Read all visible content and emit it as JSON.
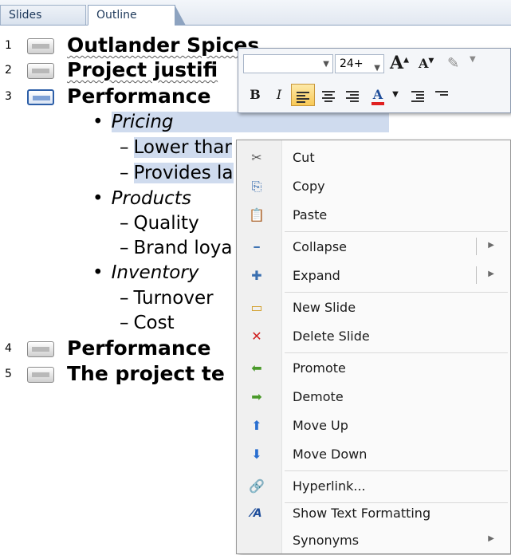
{
  "tabs": {
    "slides": "Slides",
    "outline": "Outline"
  },
  "outline": {
    "slides": [
      {
        "num": "1",
        "title": "Outlander Spices"
      },
      {
        "num": "2",
        "title": "Project justifi"
      },
      {
        "num": "3",
        "title": "Performance"
      },
      {
        "num": "4",
        "title": "Performance"
      },
      {
        "num": "5",
        "title": "The project te"
      }
    ],
    "bullets": [
      {
        "text": "Pricing",
        "subs": [
          "Lower thar",
          "Provides la"
        ]
      },
      {
        "text": "Products",
        "subs": [
          "Quality",
          "Brand loya"
        ]
      },
      {
        "text": "Inventory",
        "subs": [
          "Turnover",
          "Cost"
        ]
      }
    ],
    "bullet_char": "•",
    "sub_dash": "–"
  },
  "mini_toolbar": {
    "font_size": "24+",
    "grow_label": "A",
    "shrink_label": "A",
    "bold": "B",
    "italic": "I",
    "font_color_label": "A",
    "accent_colors": {
      "font_color_bar": "#e02020",
      "highlight": "#f8c956"
    }
  },
  "context_menu": {
    "items": [
      {
        "icon": "cut-icon",
        "label": "Cut",
        "glyph": "✂"
      },
      {
        "icon": "copy-icon",
        "label": "Copy",
        "glyph": "⎘"
      },
      {
        "icon": "paste-icon",
        "label": "Paste",
        "glyph": "📋"
      },
      {
        "icon": "collapse-icon",
        "label": "Collapse",
        "glyph": "━",
        "submenu": true
      },
      {
        "icon": "expand-icon",
        "label": "Expand",
        "glyph": "✚",
        "submenu": true
      },
      {
        "icon": "new-slide-icon",
        "label": "New Slide",
        "glyph": "▭"
      },
      {
        "icon": "delete-slide-icon",
        "label": "Delete Slide",
        "glyph": "✕"
      },
      {
        "icon": "promote-icon",
        "label": "Promote",
        "glyph": "⬅"
      },
      {
        "icon": "demote-icon",
        "label": "Demote",
        "glyph": "➡"
      },
      {
        "icon": "move-up-icon",
        "label": "Move Up",
        "glyph": "⬆"
      },
      {
        "icon": "move-down-icon",
        "label": "Move Down",
        "glyph": "⬇"
      },
      {
        "icon": "hyperlink-icon",
        "label": "Hyperlink...",
        "glyph": "🔗"
      },
      {
        "icon": "show-text-formatting-icon",
        "label": "Show Text Formatting",
        "glyph": "⁄A"
      },
      {
        "icon": "synonyms-icon",
        "label": "Synonyms",
        "glyph": "",
        "submenu": true
      }
    ]
  }
}
